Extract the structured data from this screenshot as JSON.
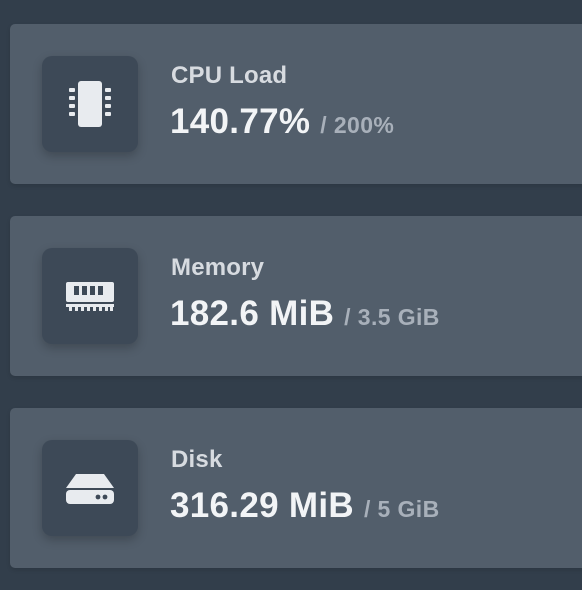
{
  "stats": [
    {
      "name": "cpu",
      "icon": "cpu-chip-icon",
      "label": "CPU Load",
      "value": "140.77%",
      "limit": "/ 200%"
    },
    {
      "name": "memory",
      "icon": "memory-ram-icon",
      "label": "Memory",
      "value": "182.6 MiB",
      "limit": "/ 3.5 GiB"
    },
    {
      "name": "disk",
      "icon": "hard-drive-icon",
      "label": "Disk",
      "value": "316.29 MiB",
      "limit": "/ 5 GiB"
    }
  ],
  "colors": {
    "background": "#323e4b",
    "card": "#525e6b",
    "icon_box": "#3d4957",
    "label": "#d7dbe0",
    "value": "#f2f4f6",
    "limit": "#a8b0ba"
  }
}
